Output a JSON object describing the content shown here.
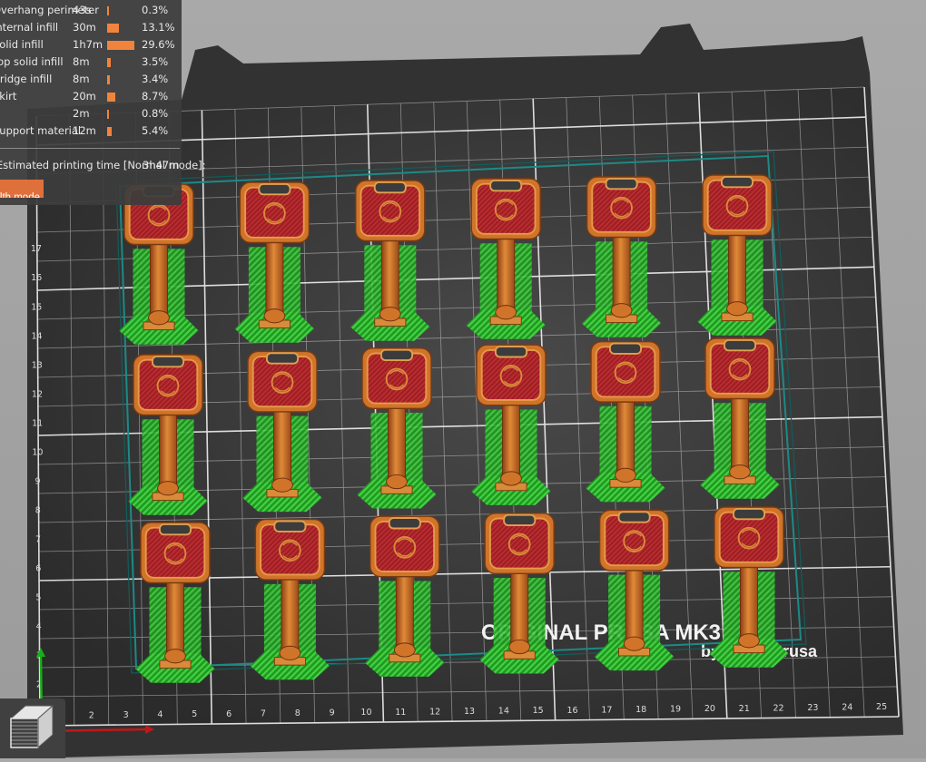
{
  "legend": {
    "rows": [
      {
        "feature": "Overhang perimeter",
        "time": "43s",
        "pct": "0.3%",
        "fraction": 0.003
      },
      {
        "feature": "Internal infill",
        "time": "30m",
        "pct": "13.1%",
        "fraction": 0.131
      },
      {
        "feature": "Solid infill",
        "time": "1h7m",
        "pct": "29.6%",
        "fraction": 0.296
      },
      {
        "feature": "Top solid infill",
        "time": "8m",
        "pct": "3.5%",
        "fraction": 0.035
      },
      {
        "feature": "Bridge infill",
        "time": "8m",
        "pct": "3.4%",
        "fraction": 0.034
      },
      {
        "feature": "Skirt",
        "time": "20m",
        "pct": "8.7%",
        "fraction": 0.087
      },
      {
        "feature": "",
        "time": "2m",
        "pct": "0.8%",
        "fraction": 0.008
      },
      {
        "feature": "Support material",
        "time": "12m",
        "pct": "5.4%",
        "fraction": 0.054
      }
    ],
    "estimate_label": "Estimated printing time [Normal mode]:",
    "estimate_value": "3h47m",
    "mode_button": "Show stealth mode"
  },
  "bed": {
    "x_ticks": [
      "1",
      "2",
      "3",
      "4",
      "5",
      "6",
      "7",
      "8",
      "9",
      "10",
      "11",
      "12",
      "13",
      "14",
      "15",
      "16",
      "17",
      "18",
      "19",
      "20",
      "21",
      "22",
      "23",
      "24",
      "25"
    ],
    "y_ticks": [
      "2",
      "3",
      "4",
      "5",
      "6",
      "7",
      "8",
      "9",
      "10",
      "11",
      "12",
      "13",
      "14",
      "15",
      "16",
      "17"
    ],
    "logo_line1": "ORIGINAL PRUSA MK3",
    "logo_line2": "by Josef Prusa"
  },
  "colors": {
    "bed_sheet": "#2e2e2e",
    "grid": "#d8d8d8",
    "support": "#2fbe2f",
    "key_outer": "#d0742a",
    "key_inner": "#a52228",
    "key_stem": "#c86a2a",
    "skirt": "#22a7a0",
    "legend_bar": "#f0843c"
  },
  "objects": {
    "rows": 3,
    "cols": 6,
    "type": "key"
  },
  "icons": {
    "layers": "layers-icon",
    "x_axis": "x-axis-arrow-icon",
    "y_axis": "y-axis-arrow-icon"
  }
}
